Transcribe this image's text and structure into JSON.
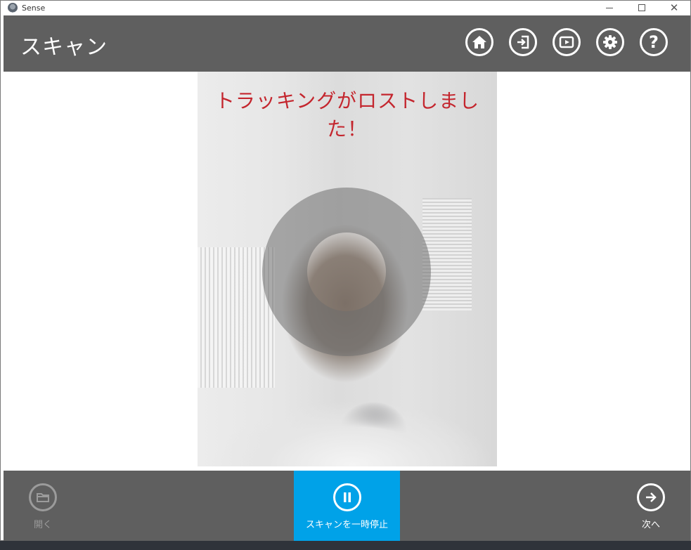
{
  "window": {
    "title": "Sense",
    "controls": {
      "minimize": "—",
      "maximize": "☐",
      "close": "✕"
    }
  },
  "header": {
    "title": "スキャン",
    "icons": [
      "home-icon",
      "sign-in-icon",
      "play-icon",
      "gear-icon",
      "help-icon"
    ],
    "help_glyph": "?"
  },
  "scan": {
    "status_message": "トラッキングがロストしました！"
  },
  "footer": {
    "open_label": "開く",
    "pause_label": "スキャンを一時停止",
    "next_label": "次へ"
  },
  "colors": {
    "header_bg": "#5f5f5f",
    "accent": "#00a2e8",
    "error_text": "#c4262e"
  }
}
